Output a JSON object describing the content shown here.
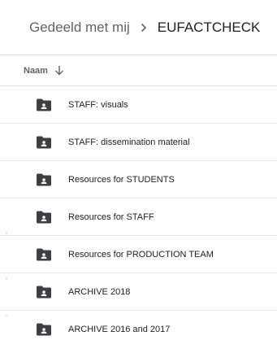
{
  "breadcrumb": {
    "parent": "Gedeeld met mij",
    "separator_icon": "chevron-right-icon",
    "current": "EUFACTCHECK"
  },
  "list_header": {
    "name_column": "Naam",
    "sort_icon": "arrow-down-icon"
  },
  "files": [
    {
      "name": "STAFF: visuals",
      "icon": "shared-folder-icon"
    },
    {
      "name": "STAFF: dissemination material",
      "icon": "shared-folder-icon"
    },
    {
      "name": "Resources for STUDENTS",
      "icon": "shared-folder-icon"
    },
    {
      "name": "Resources for STAFF",
      "icon": "shared-folder-icon"
    },
    {
      "name": "Resources for PRODUCTION TEAM",
      "icon": "shared-folder-icon"
    },
    {
      "name": "ARCHIVE 2018",
      "icon": "shared-folder-icon"
    },
    {
      "name": "ARCHIVE 2016 and 2017",
      "icon": "shared-folder-icon"
    }
  ],
  "colors": {
    "folder": "#3c4043",
    "text_primary": "#202124",
    "text_secondary": "#5f6368",
    "divider": "#e0e0e0"
  }
}
